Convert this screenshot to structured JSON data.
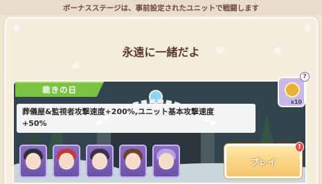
{
  "header": {
    "notice": "ボーナスステージは、事前設定されたユニットで戦闘します"
  },
  "stage": {
    "title": "永遠に一緒だよ"
  },
  "event": {
    "tag_label": "裁きの日",
    "description_line1": "葬儀屋&監視者攻撃速度+200%,ユニット基本攻撃速度",
    "description_line2": "+50%"
  },
  "reward": {
    "icon": "coin-reward-icon",
    "count": "x10"
  },
  "help": {
    "label": "?"
  },
  "units": [
    {
      "name": "unit-slot-1",
      "icon": "character-portrait"
    },
    {
      "name": "unit-slot-2",
      "icon": "character-portrait"
    },
    {
      "name": "unit-slot-3",
      "icon": "character-portrait"
    },
    {
      "name": "unit-slot-4",
      "icon": "character-portrait"
    },
    {
      "name": "unit-slot-5",
      "icon": "character-portrait"
    }
  ],
  "actions": {
    "play_label": "プレイ",
    "alert": "!"
  },
  "colors": {
    "accent_green": "#7bc144",
    "unit_purple": "#7a60b8",
    "play_gold": "#f6c56a",
    "alert_red": "#e54848"
  }
}
